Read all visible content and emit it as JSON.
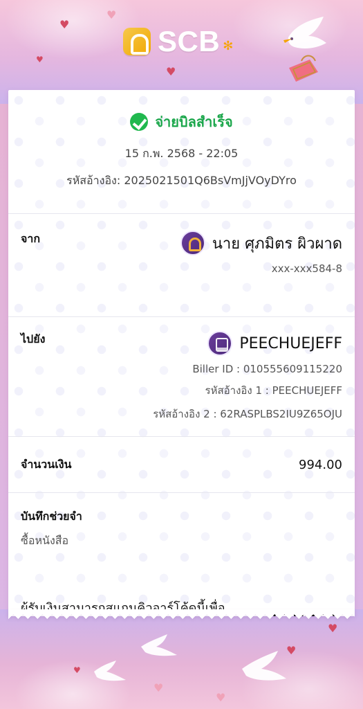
{
  "brand": {
    "name": "SCB"
  },
  "receipt": {
    "status": {
      "title": "จ่ายบิลสำเร็จ",
      "datetime": "15 ก.พ. 2568 - 22:05",
      "reference": "รหัสอ้างอิง: 2025021501Q6BsVmJjVOyDYro"
    },
    "from": {
      "label": "จาก",
      "name": "นาย ศุภมิตร ผิวผาด",
      "account": "xxx-xxx584-8"
    },
    "to": {
      "label": "ไปยัง",
      "name": "PEECHUEJEFF",
      "biller_id": "Biller ID : 010555609115220",
      "ref1": "รหัสอ้างอิง 1 : PEECHUEJEFF",
      "ref2": "รหัสอ้างอิง 2 : 62RASPLBS2IU9Z65OJU"
    },
    "amount": {
      "label": "จำนวนเงิน",
      "value": "994.00"
    },
    "memo": {
      "label": "บันทึกช่วยจำ",
      "value": "ซื้อหนังสือ"
    },
    "qr": {
      "text": "ผู้รับเงินสามารถสแกนคิวอาร์โค้ดนี้เพื่อตรวจสอบสถานะการจ่ายเงิน"
    }
  },
  "icons": {
    "success": "check-circle-icon",
    "bank_avatar": "scb-logo-icon",
    "biller_avatar": "biller-icon",
    "qr": "qr-code-icon"
  }
}
